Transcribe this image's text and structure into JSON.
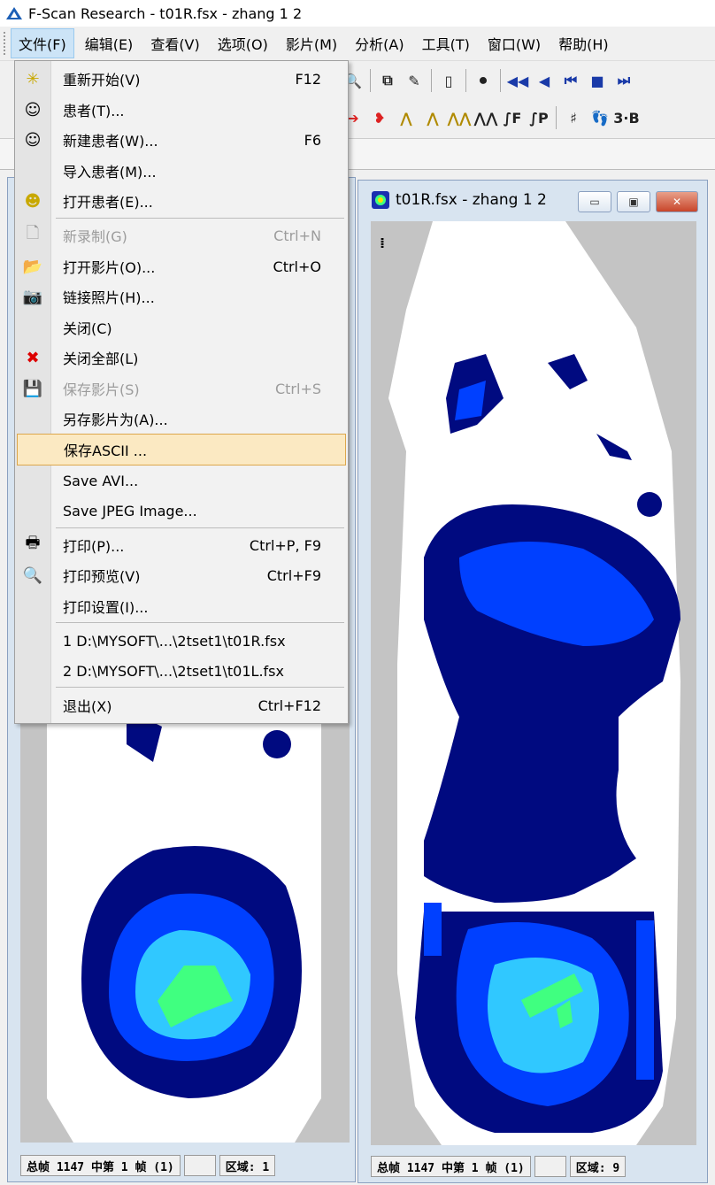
{
  "window": {
    "title": "F-Scan Research - t01R.fsx - zhang 1 2"
  },
  "menubar": {
    "items": [
      {
        "label": "文件(F)"
      },
      {
        "label": "编辑(E)"
      },
      {
        "label": "查看(V)"
      },
      {
        "label": "选项(O)"
      },
      {
        "label": "影片(M)"
      },
      {
        "label": "分析(A)"
      },
      {
        "label": "工具(T)"
      },
      {
        "label": "窗口(W)"
      },
      {
        "label": "帮助(H)"
      }
    ]
  },
  "file_menu": {
    "items": [
      {
        "label": "重新开始(V)",
        "shortcut": "F12",
        "icon": "restart-icon",
        "enabled": true
      },
      {
        "label": "患者(T)...",
        "shortcut": "",
        "icon": "patient-icon",
        "enabled": true
      },
      {
        "label": "新建患者(W)...",
        "shortcut": "F6",
        "icon": "new-patient-icon",
        "enabled": true
      },
      {
        "label": "导入患者(M)...",
        "shortcut": "",
        "icon": "",
        "enabled": true
      },
      {
        "label": "打开患者(E)...",
        "shortcut": "",
        "icon": "open-patient-icon",
        "enabled": true
      },
      {
        "label": "新录制(G)",
        "shortcut": "Ctrl+N",
        "icon": "new-recording-icon",
        "enabled": false
      },
      {
        "label": "打开影片(O)...",
        "shortcut": "Ctrl+O",
        "icon": "open-folder-icon",
        "enabled": true
      },
      {
        "label": "链接照片(H)...",
        "shortcut": "",
        "icon": "camera-icon",
        "enabled": true
      },
      {
        "label": "关闭(C)",
        "shortcut": "",
        "icon": "",
        "enabled": true
      },
      {
        "label": "关闭全部(L)",
        "shortcut": "",
        "icon": "close-all-icon",
        "enabled": true
      },
      {
        "label": "保存影片(S)",
        "shortcut": "Ctrl+S",
        "icon": "save-icon",
        "enabled": false
      },
      {
        "label": "另存影片为(A)...",
        "shortcut": "",
        "icon": "",
        "enabled": true
      },
      {
        "label": "保存ASCII ...",
        "shortcut": "",
        "icon": "",
        "enabled": true,
        "highlighted": true
      },
      {
        "label": "Save AVI...",
        "shortcut": "",
        "icon": "",
        "enabled": true
      },
      {
        "label": "Save JPEG Image...",
        "shortcut": "",
        "icon": "",
        "enabled": true
      },
      {
        "label": "打印(P)...",
        "shortcut": "Ctrl+P, F9",
        "icon": "print-icon",
        "enabled": true
      },
      {
        "label": "打印预览(V)",
        "shortcut": "Ctrl+F9",
        "icon": "print-preview-icon",
        "enabled": true
      },
      {
        "label": "打印设置(I)...",
        "shortcut": "",
        "icon": "",
        "enabled": true
      },
      {
        "label": "1 D:\\MYSOFT\\...\\2tset1\\t01R.fsx",
        "shortcut": "",
        "icon": "",
        "enabled": true
      },
      {
        "label": "2 D:\\MYSOFT\\...\\2tset1\\t01L.fsx",
        "shortcut": "",
        "icon": "",
        "enabled": true
      },
      {
        "label": "退出(X)",
        "shortcut": "Ctrl+F12",
        "icon": "",
        "enabled": true
      }
    ]
  },
  "toolbar2": {
    "labels": [
      "∫F",
      "∫P",
      "3·B"
    ]
  },
  "right_window": {
    "title": "t01R.fsx - zhang 1 2",
    "status": [
      "总帧 1147 中第 1 帧 (1)",
      "",
      "区域: 9"
    ]
  },
  "left_window": {
    "status": [
      "总帧 1147 中第 1 帧 (1)",
      "",
      "区域: 1"
    ]
  },
  "colors": {
    "highlight": "#fbe9c2",
    "pressure_dark": "#000a80",
    "pressure_mid": "#0040ff",
    "pressure_light": "#30c8ff",
    "pressure_green": "#40ff80",
    "sensor_bg": "#c4c4c4"
  }
}
